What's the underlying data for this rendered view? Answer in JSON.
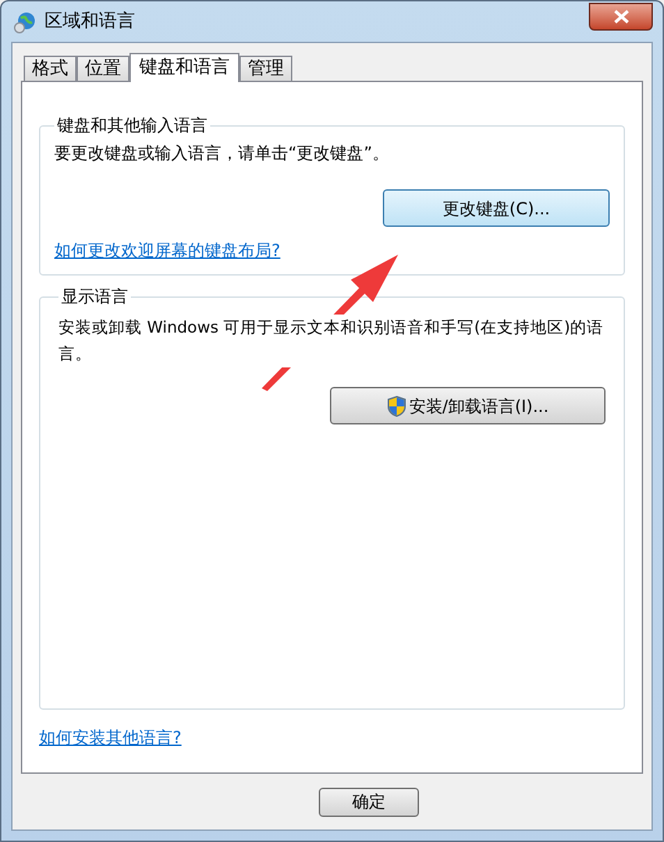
{
  "window": {
    "title": "区域和语言"
  },
  "tabs": [
    {
      "label": "格式",
      "selected": false
    },
    {
      "label": "位置",
      "selected": false
    },
    {
      "label": "键盘和语言",
      "selected": true
    },
    {
      "label": "管理",
      "selected": false
    }
  ],
  "keyboard_group": {
    "title": "键盘和其他输入语言",
    "text": "要更改键盘或输入语言，请单击“更改键盘”。",
    "button": "更改键盘(C)...",
    "link": "如何更改欢迎屏幕的键盘布局?"
  },
  "display_group": {
    "title": "显示语言",
    "text": "安装或卸载 Windows 可用于显示文本和识别语音和手写(在支持地区)的语言。",
    "button": "安装/卸载语言(I)..."
  },
  "bottom_link": "如何安装其他语言?",
  "buttons": [
    "确定"
  ]
}
